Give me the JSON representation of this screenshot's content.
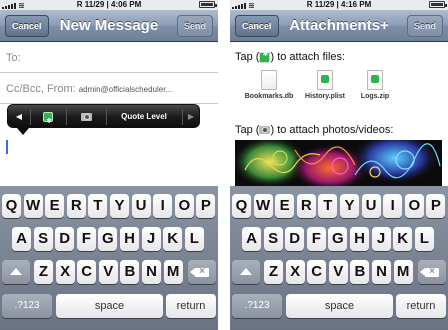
{
  "status_bar": {
    "carrier_left": "R 11/29 | 4:06 PM",
    "carrier_right": "R 11/29 | 4:16 PM"
  },
  "compose": {
    "nav": {
      "cancel_label": "Cancel",
      "title": "New Message",
      "send_label": "Send"
    },
    "to_label": "To:",
    "ccbcc_label": "Cc/Bcc, From:",
    "from_value": "admin@officialscheduler...",
    "popup": {
      "left_arrow": "◀",
      "right_arrow": "▶",
      "quote_level": "Quote Level"
    }
  },
  "attachments": {
    "nav": {
      "cancel_label": "Cancel",
      "title": "Attachments+",
      "send_label": "Send"
    },
    "files_instruction_before": "Tap (",
    "files_instruction_after": ") to attach files:",
    "photos_instruction_before": "Tap (",
    "photos_instruction_after": ") to attach photos/videos:",
    "files": [
      {
        "name": "Bookmarks.db",
        "icon": "blank-document-icon"
      },
      {
        "name": "History.plist",
        "icon": "generic-file-icon"
      },
      {
        "name": "Logs.zip",
        "icon": "generic-file-icon"
      }
    ]
  },
  "keyboard": {
    "row1": [
      "Q",
      "W",
      "E",
      "R",
      "T",
      "Y",
      "U",
      "I",
      "O",
      "P"
    ],
    "row2": [
      "A",
      "S",
      "D",
      "F",
      "G",
      "H",
      "J",
      "K",
      "L"
    ],
    "row3": [
      "Z",
      "X",
      "C",
      "V",
      "B",
      "N",
      "M"
    ],
    "numbers_label": ".?123",
    "space_label": "space",
    "return_label": "return"
  },
  "colors": {
    "navbar": "#7d8fa9",
    "keyboard_bg": "#6a7383",
    "accent_green": "#2fb34a",
    "cursor": "#3b6fd6"
  }
}
